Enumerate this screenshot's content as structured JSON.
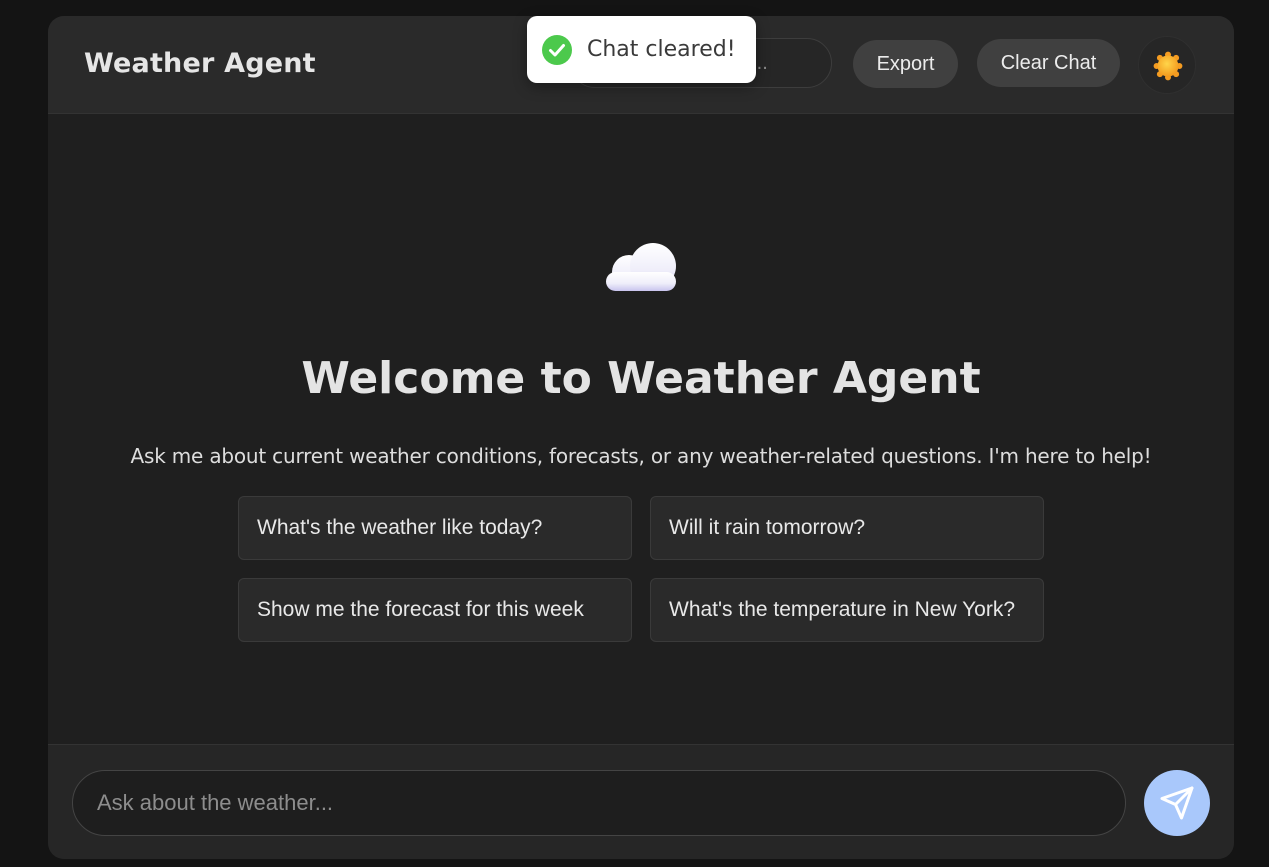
{
  "header": {
    "title": "Weather Agent",
    "search_placeholder": "Search messages...",
    "export_label": "Export",
    "clear_label": "Clear Chat",
    "theme_icon": "sun-icon"
  },
  "toast": {
    "icon": "check-circle-icon",
    "message": "Chat cleared!"
  },
  "welcome": {
    "icon": "cloud-icon",
    "title": "Welcome to Weather Agent",
    "subtitle": "Ask me about current weather conditions, forecasts, or any weather-related questions. I'm here to help!",
    "suggestions": [
      {
        "label": "What's the weather like today?"
      },
      {
        "label": "Will it rain tomorrow?"
      },
      {
        "label": "Show me the forecast for this week"
      },
      {
        "label": "What's the temperature in New York?"
      }
    ]
  },
  "composer": {
    "placeholder": "Ask about the weather...",
    "send_icon": "send-icon"
  },
  "colors": {
    "background": "#141414",
    "panel": "#1f1f1f",
    "header": "#2a2a2a",
    "accent": "#a9c8fb",
    "toast_success": "#4cc94c"
  }
}
